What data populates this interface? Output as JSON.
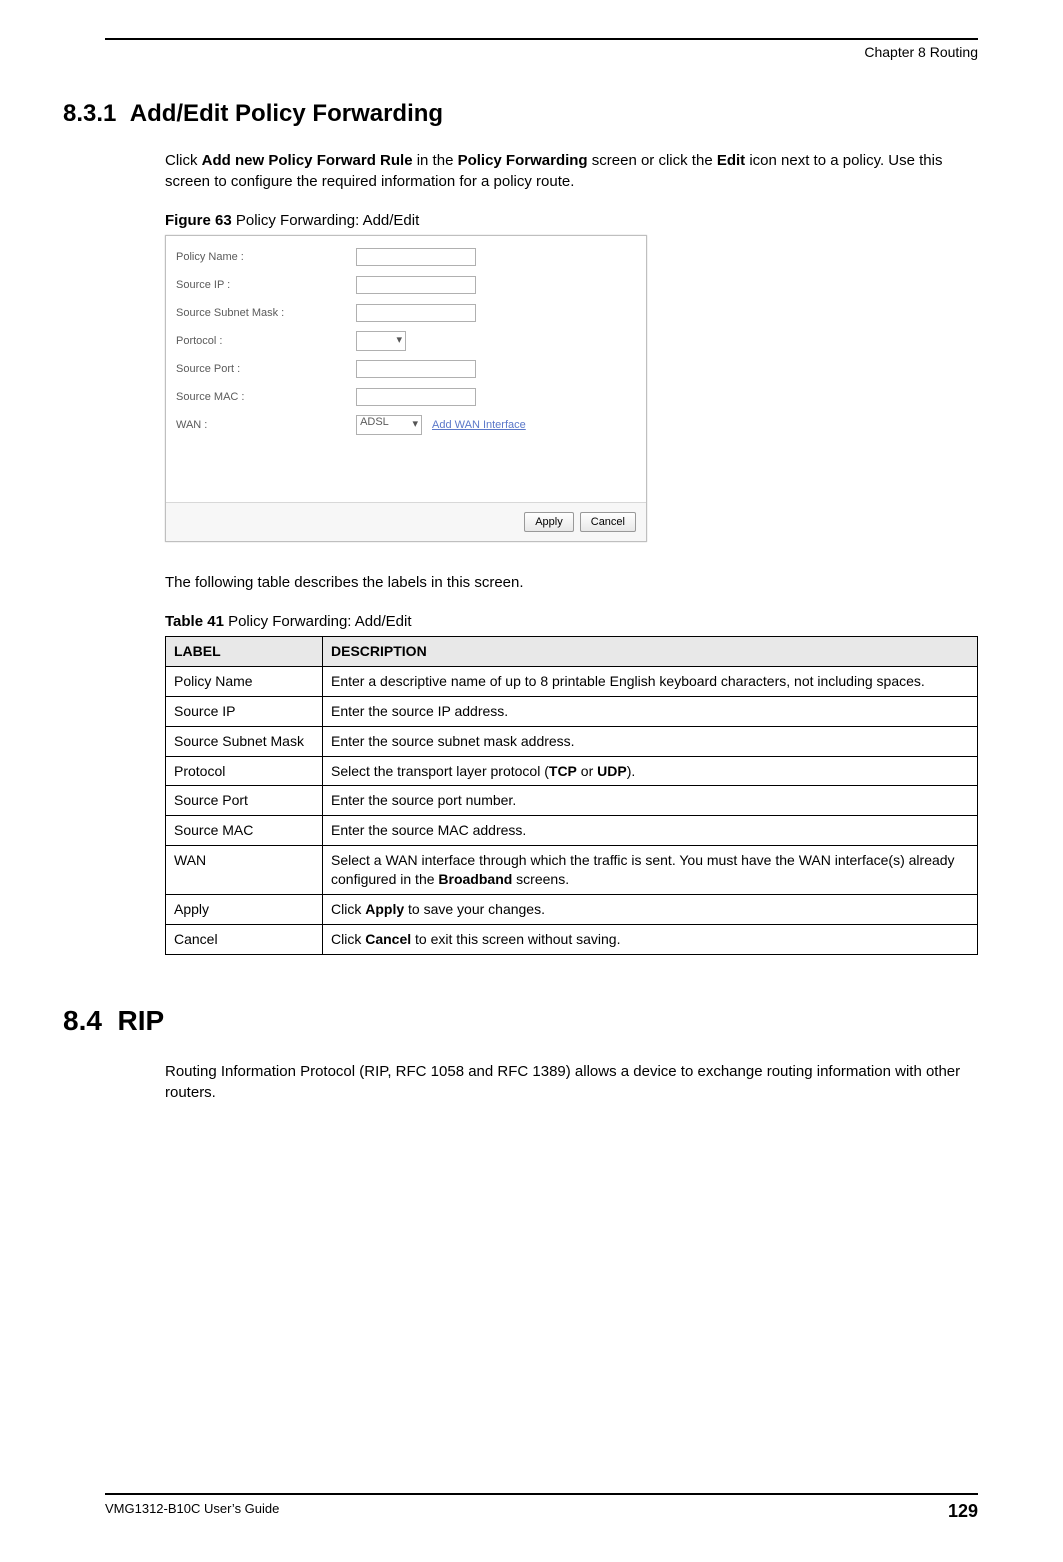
{
  "header": {
    "chapter": "Chapter 8 Routing"
  },
  "section1": {
    "number": "8.3.1",
    "title": "Add/Edit Policy Forwarding",
    "intro": {
      "prefix": "Click ",
      "b1": "Add new Policy Forward Rule",
      "mid1": " in the ",
      "b2": "Policy Forwarding",
      "mid2": " screen or click the ",
      "b3": "Edit",
      "suffix": " icon next to a policy. Use this screen to configure the required information for a policy route."
    },
    "figure_caption_num": "Figure 63",
    "figure_caption_text": "   Policy Forwarding: Add/Edit",
    "screenshot": {
      "rows": [
        {
          "label": "Policy Name :",
          "type": "input"
        },
        {
          "label": "Source IP :",
          "type": "input"
        },
        {
          "label": "Source Subnet Mask :",
          "type": "input"
        },
        {
          "label": "Portocol :",
          "type": "select_empty"
        },
        {
          "label": "Source Port :",
          "type": "input"
        },
        {
          "label": "Source MAC :",
          "type": "input"
        },
        {
          "label": "WAN :",
          "type": "select",
          "value": "ADSL",
          "link": "Add WAN Interface"
        }
      ],
      "apply": "Apply",
      "cancel": "Cancel"
    },
    "after_fig": "The following table describes the labels in this screen.",
    "table_caption_num": "Table 41",
    "table_caption_text": "   Policy Forwarding: Add/Edit",
    "table": {
      "head": {
        "c1": "LABEL",
        "c2": "DESCRIPTION"
      },
      "rows": [
        {
          "label": "Policy Name",
          "desc": "Enter a descriptive name of up to 8 printable English keyboard characters, not including spaces."
        },
        {
          "label": "Source IP",
          "desc": "Enter the source IP address."
        },
        {
          "label": "Source Subnet Mask",
          "desc": "Enter the source subnet mask address."
        },
        {
          "label": "Protocol",
          "desc_pre": "Select the transport layer protocol (",
          "b1": "TCP",
          "mid": " or ",
          "b2": "UDP",
          "desc_post": ")."
        },
        {
          "label": "Source Port",
          "desc": "Enter the source port number."
        },
        {
          "label": "Source MAC",
          "desc": "Enter the source MAC address."
        },
        {
          "label": "WAN",
          "desc_pre": "Select a WAN interface through which the traffic is sent. You must have the WAN interface(s) already configured in the ",
          "b1": "Broadband",
          "desc_post": " screens."
        },
        {
          "label": "Apply",
          "desc_pre": "Click ",
          "b1": "Apply",
          "desc_post": " to save your changes."
        },
        {
          "label": "Cancel",
          "desc_pre": "Click ",
          "b1": "Cancel",
          "desc_post": " to exit this screen without saving."
        }
      ]
    }
  },
  "section2": {
    "number": "8.4",
    "title": "RIP",
    "para": "Routing Information Protocol (RIP, RFC 1058 and RFC 1389) allows a device to exchange routing information with other routers."
  },
  "footer": {
    "guide": "VMG1312-B10C User’s Guide",
    "page": "129"
  }
}
